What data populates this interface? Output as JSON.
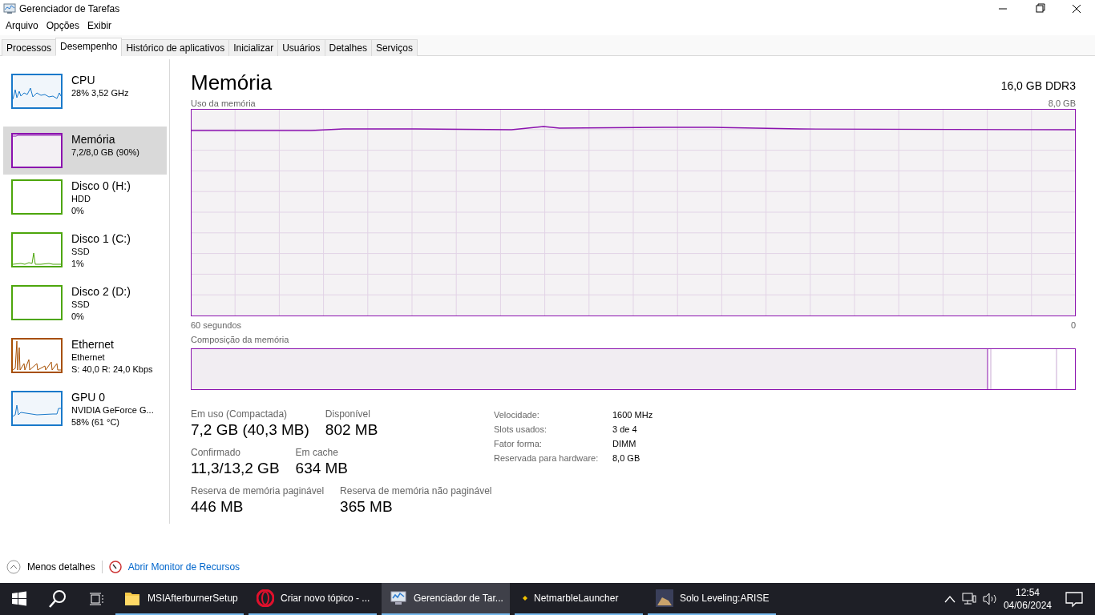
{
  "window": {
    "title": "Gerenciador de Tarefas"
  },
  "menu": [
    "Arquivo",
    "Opções",
    "Exibir"
  ],
  "tabs": [
    {
      "label": "Processos",
      "selected": false
    },
    {
      "label": "Desempenho",
      "selected": true
    },
    {
      "label": "Histórico de aplicativos",
      "selected": false
    },
    {
      "label": "Inicializar",
      "selected": false
    },
    {
      "label": "Usuários",
      "selected": false
    },
    {
      "label": "Detalhes",
      "selected": false
    },
    {
      "label": "Serviços",
      "selected": false
    }
  ],
  "sidebar": {
    "items": [
      {
        "title": "CPU",
        "lines": [
          "28% 3,52 GHz"
        ],
        "color": "#1979ca",
        "selected": false
      },
      {
        "title": "Memória",
        "lines": [
          "7,2/8,0 GB (90%)"
        ],
        "color": "#8b12ae",
        "selected": true
      },
      {
        "title": "Disco 0 (H:)",
        "lines": [
          "HDD",
          "0%"
        ],
        "color": "#4da60c",
        "selected": false
      },
      {
        "title": "Disco 1 (C:)",
        "lines": [
          "SSD",
          "1%"
        ],
        "color": "#4da60c",
        "selected": false
      },
      {
        "title": "Disco 2 (D:)",
        "lines": [
          "SSD",
          "0%"
        ],
        "color": "#4da60c",
        "selected": false
      },
      {
        "title": "Ethernet",
        "lines": [
          "Ethernet",
          "S: 40,0 R: 24,0 Kbps"
        ],
        "color": "#a74f01",
        "selected": false
      },
      {
        "title": "GPU 0",
        "lines": [
          "NVIDIA GeForce G...",
          "58% (61 °C)"
        ],
        "color": "#1979ca",
        "selected": false
      }
    ]
  },
  "detail": {
    "title": "Memória",
    "subtitle": "16,0 GB DDR3",
    "usage_graph": {
      "label": "Uso da memória",
      "max": "8,0 GB",
      "time_span": "60 segundos",
      "min": "0"
    },
    "composition": {
      "label": "Composição da memória"
    },
    "stats": [
      [
        {
          "label": "Em uso (Compactada)",
          "value": "7,2 GB (40,3 MB)"
        },
        {
          "label": "Disponível",
          "value": "802 MB"
        }
      ],
      [
        {
          "label": "Confirmado",
          "value": "11,3/13,2 GB"
        },
        {
          "label": "Em cache",
          "value": "634 MB"
        }
      ],
      [
        {
          "label": "Reserva de memória paginável",
          "value": "446 MB"
        },
        {
          "label": "Reserva de memória não paginável",
          "value": "365 MB"
        }
      ]
    ],
    "properties": [
      {
        "label": "Velocidade:",
        "value": "1600 MHz"
      },
      {
        "label": "Slots usados:",
        "value": "3 de 4"
      },
      {
        "label": "Fator forma:",
        "value": "DIMM"
      },
      {
        "label": "Reservada para hardware:",
        "value": "8,0 GB"
      }
    ]
  },
  "footer": {
    "fewer_details": "Menos detalhes",
    "resource_monitor": "Abrir Monitor de Recursos"
  },
  "taskbar": {
    "items": [
      {
        "kind": "folder",
        "label": "MSIAfterburnerSetup",
        "selected": false
      },
      {
        "kind": "browser",
        "label": "Criar novo tópico - ...",
        "selected": false
      },
      {
        "kind": "monitor",
        "label": "Gerenciador de Tar...",
        "selected": true
      },
      {
        "kind": "launcher",
        "label": "NetmarbleLauncher",
        "selected": false
      },
      {
        "kind": "game",
        "label": "Solo Leveling:ARISE",
        "selected": false
      }
    ],
    "time": "12:54",
    "date": "04/06/2024"
  }
}
